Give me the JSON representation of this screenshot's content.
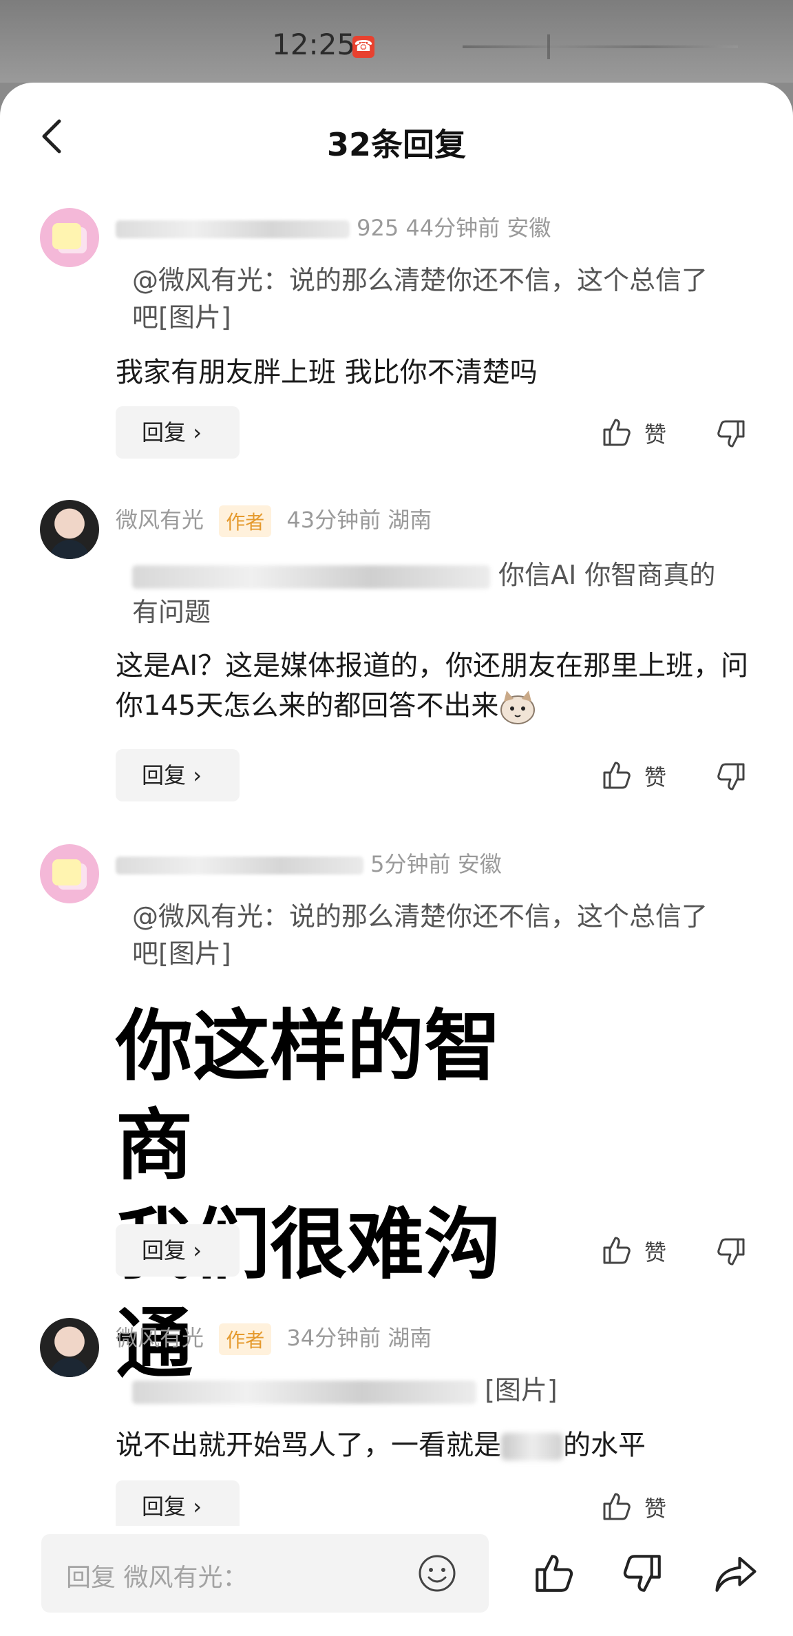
{
  "status": {
    "time": "12:25"
  },
  "header": {
    "title": "32条回复"
  },
  "comments": [
    {
      "meta_suffix": "925 44分钟前  安徽",
      "quote": "@微风有光：说的那么清楚你还不信，这个总信了吧[图片]",
      "text": "我家有朋友胖上班 我比你不清楚吗",
      "reply": "回复",
      "like": "赞"
    },
    {
      "user": "微风有光",
      "tag": "作者",
      "meta": "43分钟前  湖南",
      "quote_visible": "你信AI 你智商真的有问题",
      "text": "这是AI？这是媒体报道的，你还朋友在那里上班，问你145天怎么来的都回答不出来",
      "reply": "回复",
      "like": "赞"
    },
    {
      "meta_suffix": "5分钟前  安徽",
      "quote": "@微风有光：说的那么清楚你还不信，这个总信了吧[图片]",
      "meme_line1": "你这样的智商",
      "meme_line2": "我们很难沟通",
      "reply": "回复",
      "like": "赞"
    },
    {
      "user": "微风有光",
      "tag": "作者",
      "meta": "34分钟前  湖南",
      "quote_visible": "[图片]",
      "text": "说不出就开始骂人了，一看就是",
      "text_tail": "的水平",
      "reply": "回复",
      "like": "赞"
    }
  ],
  "bottom": {
    "placeholder": "回复 微风有光："
  }
}
